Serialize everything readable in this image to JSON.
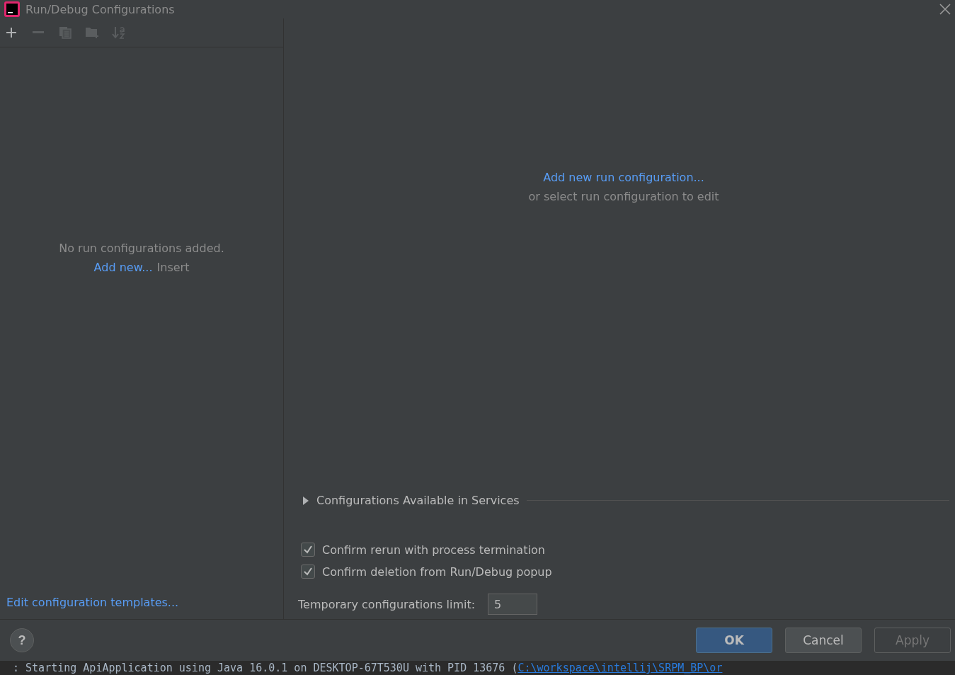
{
  "window": {
    "title": "Run/Debug Configurations"
  },
  "toolbar": [
    {
      "kind": "add",
      "disabled": false
    },
    {
      "kind": "remove",
      "disabled": true
    },
    {
      "kind": "copy",
      "disabled": true
    },
    {
      "kind": "folder",
      "disabled": true
    },
    {
      "kind": "sort",
      "disabled": true
    }
  ],
  "left_panel": {
    "empty_message": "No run configurations added.",
    "add_link": "Add new...",
    "add_shortcut": "Insert",
    "templates_link": "Edit configuration templates..."
  },
  "right_panel": {
    "add_link": "Add new run configuration...",
    "hint": "or select run configuration to edit",
    "services_section": {
      "label": "Configurations Available in Services",
      "expanded": false
    },
    "options": [
      {
        "label": "Confirm rerun with process termination",
        "checked": true
      },
      {
        "label": "Confirm deletion from Run/Debug popup",
        "checked": true
      }
    ],
    "temp_limit": {
      "label": "Temporary configurations limit:",
      "value": "5"
    }
  },
  "help_button": "?",
  "buttons": [
    {
      "label": "OK",
      "kind": "primary",
      "disabled": false
    },
    {
      "label": "Cancel",
      "kind": "normal",
      "disabled": false
    },
    {
      "label": "Apply",
      "kind": "normal",
      "disabled": true
    }
  ],
  "console_line": {
    "text": ": Starting ApiApplication using Java 16.0.1 on DESKTOP-67T530U with PID 13676 (",
    "link": "C:\\workspace\\intellij\\SRPM_BP\\or"
  }
}
